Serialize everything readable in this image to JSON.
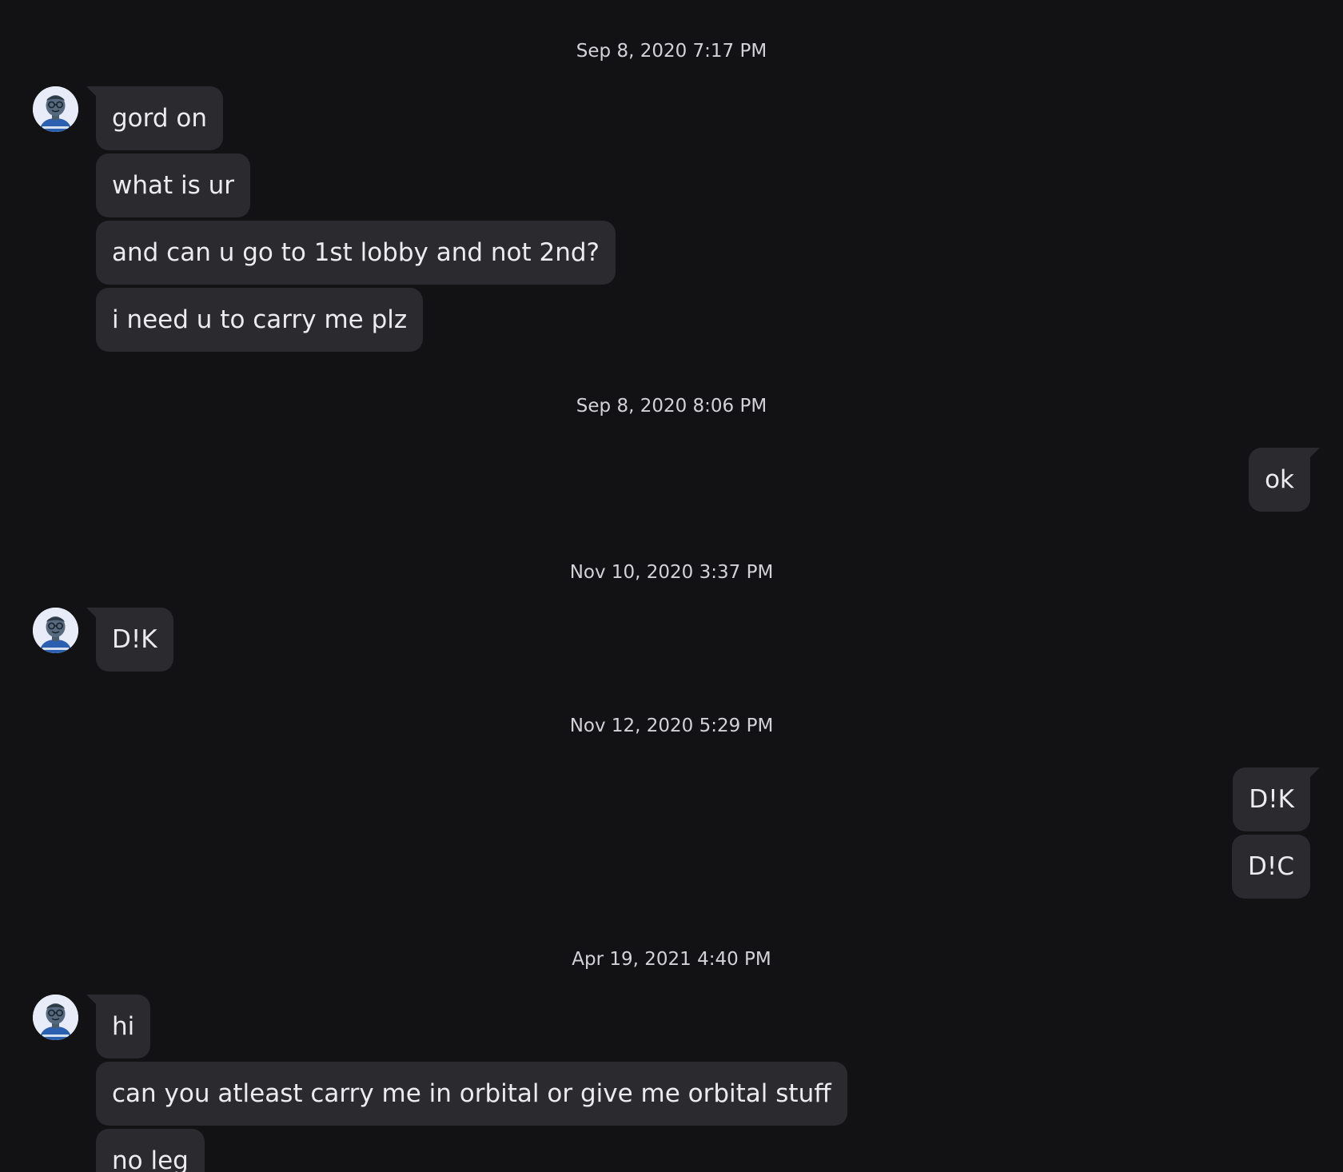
{
  "conversation": {
    "sections": [
      {
        "timestamp": "Sep 8, 2020 7:17 PM",
        "direction": "incoming",
        "messages": [
          "gord on",
          "what is ur",
          "and can u go to 1st lobby and not 2nd?",
          "i need u to carry me plz"
        ]
      },
      {
        "timestamp": "Sep 8, 2020 8:06 PM",
        "direction": "outgoing",
        "messages": [
          "ok"
        ]
      },
      {
        "timestamp": "Nov 10, 2020 3:37 PM",
        "direction": "incoming",
        "messages": [
          "D!K"
        ]
      },
      {
        "timestamp": "Nov 12, 2020 5:29 PM",
        "direction": "outgoing",
        "messages": [
          "D!K",
          "D!C"
        ]
      },
      {
        "timestamp": "Apr 19, 2021 4:40 PM",
        "direction": "incoming",
        "messages": [
          "hi",
          "can you atleast carry me in orbital or give me orbital stuff",
          "no leg"
        ]
      }
    ]
  },
  "avatar": {
    "icon": "user-avatar-icon"
  },
  "colors": {
    "background": "#121215",
    "bubble": "#2a2a2f",
    "text": "#ececf0",
    "timestamp": "#d2d2d7"
  }
}
